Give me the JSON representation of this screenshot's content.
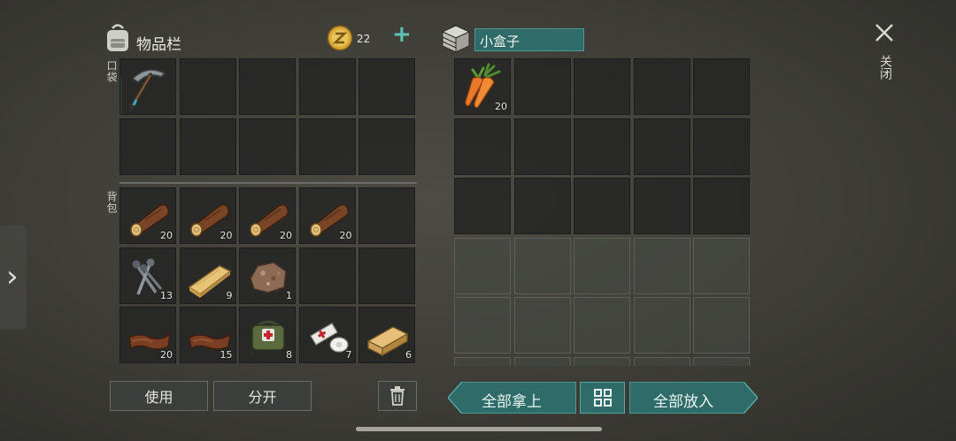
{
  "inventory": {
    "title": "物品栏",
    "coins": "22",
    "add_label": "+",
    "pocket_label": "口袋",
    "backpack_label": "背包",
    "pocket_items": [
      {
        "name": "pickaxe",
        "qty": ""
      }
    ],
    "backpack_items": [
      {
        "name": "log",
        "qty": "20"
      },
      {
        "name": "log",
        "qty": "20"
      },
      {
        "name": "log",
        "qty": "20"
      },
      {
        "name": "log",
        "qty": "20"
      },
      {
        "name": "",
        "qty": ""
      },
      {
        "name": "nails",
        "qty": "13"
      },
      {
        "name": "plank",
        "qty": "9"
      },
      {
        "name": "iron-ore",
        "qty": "1"
      },
      {
        "name": "",
        "qty": ""
      },
      {
        "name": "",
        "qty": ""
      },
      {
        "name": "leather",
        "qty": "20"
      },
      {
        "name": "leather",
        "qty": "15"
      },
      {
        "name": "first-aid-bag",
        "qty": "8"
      },
      {
        "name": "bandage",
        "qty": "7"
      },
      {
        "name": "wood-block",
        "qty": "6"
      }
    ]
  },
  "container": {
    "title": "小盒子",
    "items": [
      {
        "name": "carrot",
        "qty": "20"
      }
    ]
  },
  "buttons": {
    "use": "使用",
    "split": "分开",
    "take_all": "全部拿上",
    "put_all": "全部放入",
    "close": "关闭"
  },
  "colors": {
    "accent_teal": "#2f6b68",
    "coin_gold": "#d9a93a"
  }
}
